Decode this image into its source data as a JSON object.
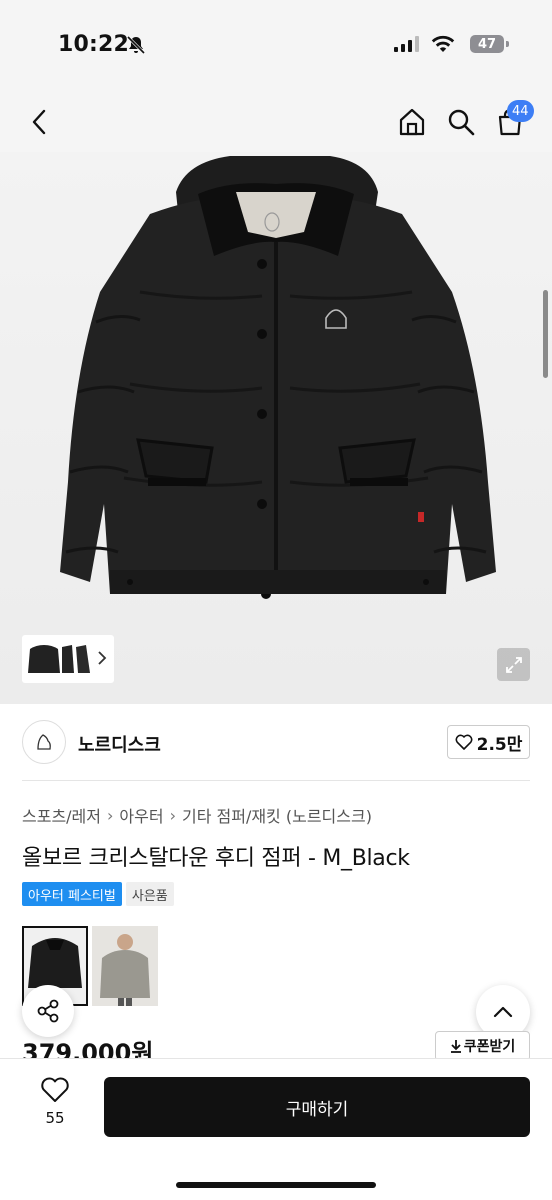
{
  "status_bar": {
    "time": "10:22",
    "battery": "47"
  },
  "nav": {
    "cart_count": "44"
  },
  "brand": {
    "name": "노르디스크",
    "likes": "2.5만"
  },
  "breadcrumb": [
    {
      "label": "스포츠/레저"
    },
    {
      "label": "아우터"
    },
    {
      "label": "기타 점퍼/재킷 (노르디스크)"
    }
  ],
  "product": {
    "title": "올보르 크리스탈다운 후디 점퍼 - M_Black",
    "tags": [
      "아우터 페스티벌",
      "사은품"
    ],
    "price": "379,000원"
  },
  "actions": {
    "coupon_label": "쿠폰받기",
    "wish_count": "55",
    "buy_label": "구매하기"
  },
  "colors": {
    "badge_blue": "#3d7ef5",
    "tag_blue": "#1e8ef0",
    "buy_bg": "#111111"
  }
}
